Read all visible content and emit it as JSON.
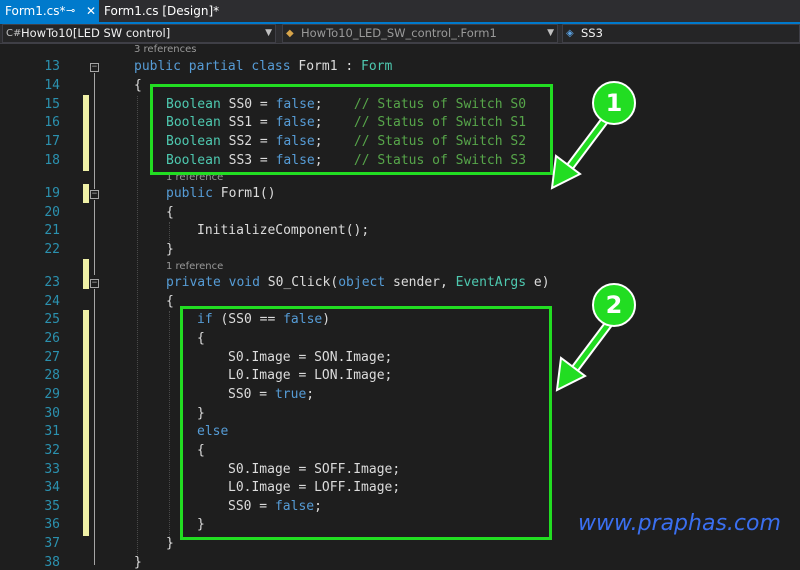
{
  "tabs": {
    "active": "Form1.cs*",
    "inactive": "Form1.cs [Design]*",
    "pin_icon": "pin-icon",
    "close_icon": "close-icon"
  },
  "navbar": {
    "project": "HowTo10[LED SW control]",
    "class": "HowTo10_LED_SW_control_.Form1",
    "member": "SS3",
    "project_icon": "csharp-project-icon",
    "class_icon": "class-icon",
    "member_icon": "field-icon"
  },
  "code_lens": {
    "class_refs": "3 references",
    "ctor_refs": "1 reference",
    "method_refs": "1 reference"
  },
  "line_numbers": [
    "13",
    "14",
    "15",
    "16",
    "17",
    "18",
    "19",
    "20",
    "21",
    "22",
    "23",
    "24",
    "25",
    "26",
    "27",
    "28",
    "29",
    "30",
    "31",
    "32",
    "33",
    "34",
    "35",
    "36",
    "37",
    "38"
  ],
  "code": {
    "l13": {
      "kw1": "public",
      "kw2": "partial",
      "kw3": "class",
      "name": "Form1",
      "sep": " : ",
      "type": "Form"
    },
    "l14": "{",
    "fields": [
      {
        "type": "Boolean",
        "name": "SS0",
        "eq": " = ",
        "val": "false",
        "end": ";",
        "comment": "// Status of Switch S0"
      },
      {
        "type": "Boolean",
        "name": "SS1",
        "eq": " = ",
        "val": "false",
        "end": ";",
        "comment": "// Status of Switch S1"
      },
      {
        "type": "Boolean",
        "name": "SS2",
        "eq": " = ",
        "val": "false",
        "end": ";",
        "comment": "// Status of Switch S2"
      },
      {
        "type": "Boolean",
        "name": "SS3",
        "eq": " = ",
        "val": "false",
        "end": ";",
        "comment": "// Status of Switch S3"
      }
    ],
    "l19": {
      "kw": "public",
      "name": "Form1()"
    },
    "l20": "{",
    "l21": "InitializeComponent();",
    "l22": "}",
    "l23": {
      "kw1": "private",
      "kw2": "void",
      "name": "S0_Click(",
      "kw3": "object",
      "p1": " sender, ",
      "type": "EventArgs",
      "p2": " e)"
    },
    "l24": "{",
    "l25": {
      "kw": "if",
      "rest": " (SS0 == ",
      "val": "false",
      "close": ")"
    },
    "l26": "{",
    "l27": "S0.Image = SON.Image;",
    "l28": "L0.Image = LON.Image;",
    "l29": {
      "text": "SS0 = ",
      "val": "true",
      "end": ";"
    },
    "l30": "}",
    "l31": "else",
    "l32": "{",
    "l33": "S0.Image = SOFF.Image;",
    "l34": "L0.Image = LOFF.Image;",
    "l35": {
      "text": "SS0 = ",
      "val": "false",
      "end": ";"
    },
    "l36": "}",
    "l37": "}",
    "l38": "}"
  },
  "callouts": [
    "1",
    "2"
  ],
  "watermark": "www.praphas.com",
  "colors": {
    "highlight": "#22dd22",
    "keyword": "#569cd6",
    "type": "#4ec9b0",
    "comment": "#57a64a",
    "accent": "#007acc"
  }
}
